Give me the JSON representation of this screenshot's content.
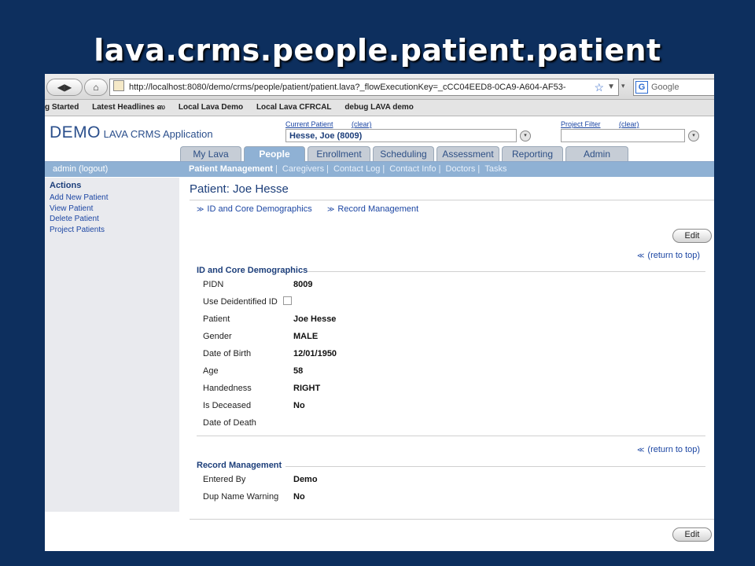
{
  "slide": {
    "title": "lava.crms.people.patient.patient"
  },
  "browser": {
    "back_glyph": "◀▶",
    "home_glyph": "⌂",
    "url": "http://localhost:8080/demo/crms/people/patient/patient.lava?_flowExecutionKey=_cCC04EED8-0CA9-A604-AF53-",
    "search_placeholder": "Google",
    "search_icon_letter": "G",
    "bookmarks": [
      "g Started",
      "Latest Headlines ஸ",
      "Local Lava Demo",
      "Local Lava CFRCAL",
      "debug LAVA demo"
    ]
  },
  "app": {
    "logo_demo": "DEMO",
    "logo_rest": "LAVA CRMS Application",
    "current_patient_label": "Current Patient",
    "current_patient_clear": "(clear)",
    "current_patient_value": "Hesse, Joe (8009)",
    "project_filter_label": "Project Filter",
    "project_filter_clear": "(clear)",
    "project_filter_value": ""
  },
  "tabs": [
    {
      "label": "My Lava"
    },
    {
      "label": "People"
    },
    {
      "label": "Enrollment"
    },
    {
      "label": "Scheduling"
    },
    {
      "label": "Assessment"
    },
    {
      "label": "Reporting"
    },
    {
      "label": "Admin"
    }
  ],
  "subnav": {
    "user": "admin",
    "logout": "(logout)",
    "items": [
      "Patient Management",
      "Caregivers",
      "Contact Log",
      "Contact Info",
      "Doctors",
      "Tasks"
    ]
  },
  "sidebar": {
    "title": "Actions",
    "items": [
      "Add New Patient",
      "View Patient",
      "Delete Patient",
      "Project Patients"
    ]
  },
  "main": {
    "title": "Patient: Joe Hesse",
    "anchor_links": [
      "ID and Core Demographics",
      "Record Management"
    ],
    "edit_label": "Edit",
    "return_to_top": "(return to top)",
    "section1": {
      "title": "ID and Core Demographics",
      "fields": [
        {
          "label": "PIDN",
          "value": "8009"
        },
        {
          "label": "Use Deidentified ID",
          "value": ""
        },
        {
          "label": "Patient",
          "value": "Joe Hesse"
        },
        {
          "label": "Gender",
          "value": "MALE"
        },
        {
          "label": "Date of Birth",
          "value": "12/01/1950"
        },
        {
          "label": "Age",
          "value": "58"
        },
        {
          "label": "Handedness",
          "value": "RIGHT"
        },
        {
          "label": "Is Deceased",
          "value": "No"
        },
        {
          "label": "Date of Death",
          "value": ""
        }
      ]
    },
    "section2": {
      "title": "Record Management",
      "fields": [
        {
          "label": "Entered By",
          "value": "Demo"
        },
        {
          "label": "Dup Name Warning",
          "value": "No"
        }
      ]
    }
  }
}
